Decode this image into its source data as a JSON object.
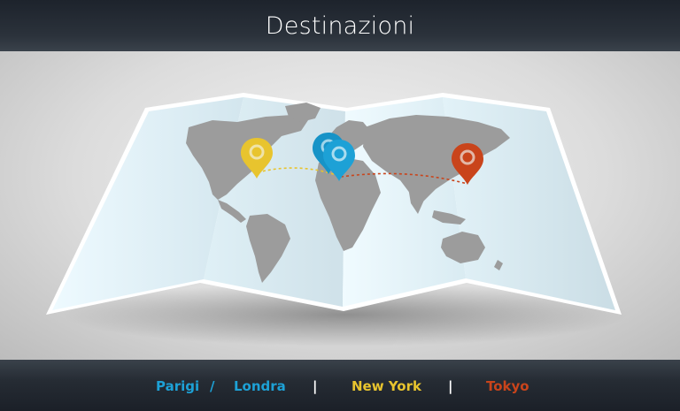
{
  "header": {
    "title": "Destinazioni"
  },
  "destinations": [
    {
      "id": "parigi",
      "label": "Parigi",
      "color": "#1da1d6"
    },
    {
      "id": "londra",
      "label": "Londra",
      "color": "#1da1d6"
    },
    {
      "id": "newyork",
      "label": "New York",
      "color": "#e8c42e"
    },
    {
      "id": "tokyo",
      "label": "Tokyo",
      "color": "#c9441b"
    }
  ],
  "separators": {
    "slash": "/",
    "bar": "|"
  },
  "icons": [
    "map-icon",
    "map-pin-icon"
  ],
  "colors": {
    "map_paper": "#e8f6fb",
    "land": "#9b9b9b",
    "blue_pin": "#1da1d6",
    "yellow_pin": "#e8c42e",
    "red_pin": "#c9441b"
  }
}
